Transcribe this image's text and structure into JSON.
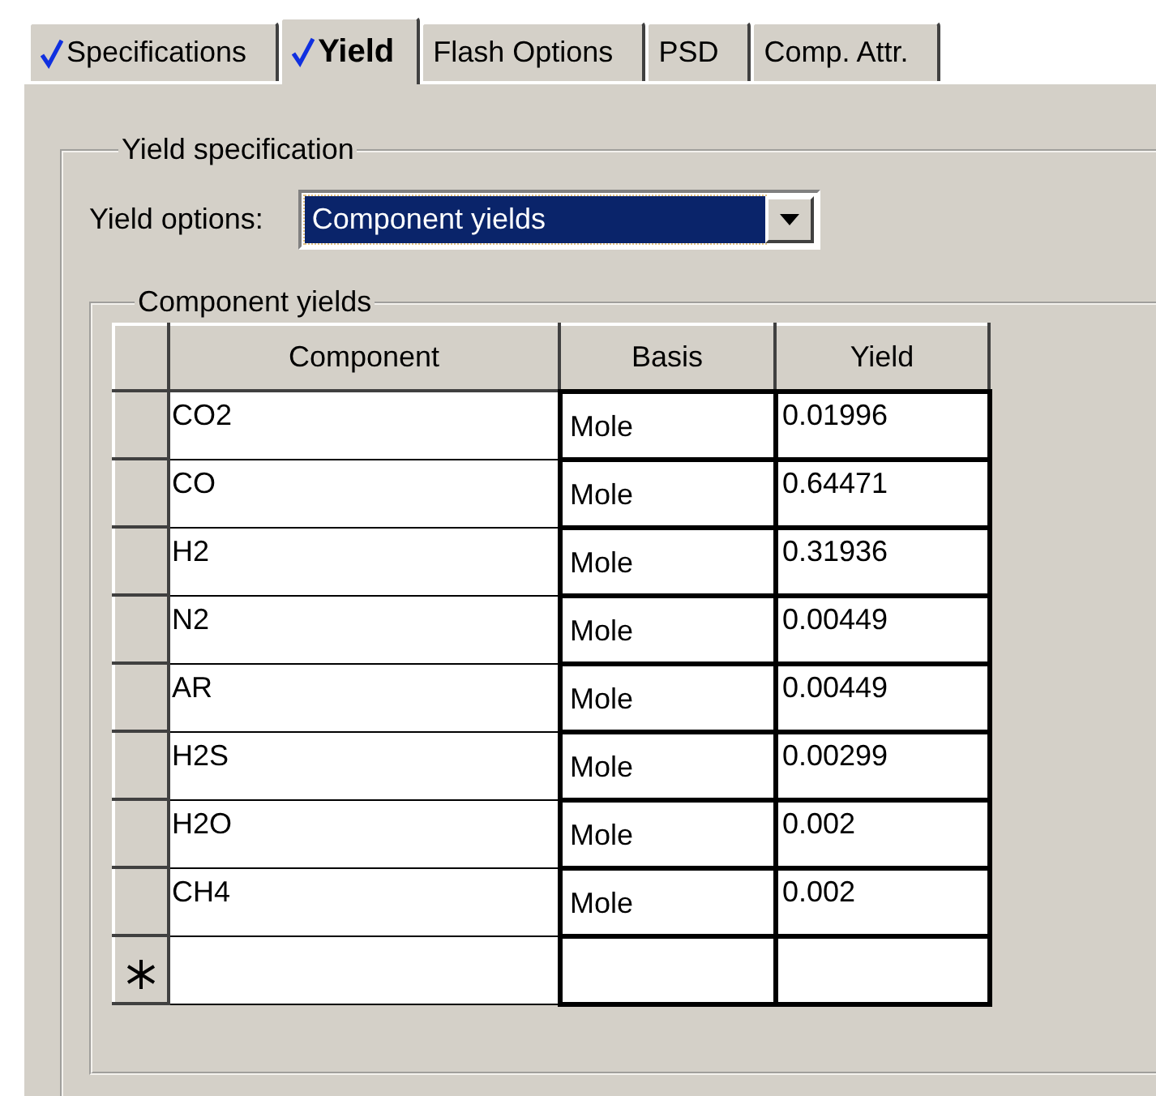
{
  "tabs": [
    {
      "label": "Specifications",
      "checked": true,
      "selected": false
    },
    {
      "label": "Yield",
      "checked": true,
      "selected": true
    },
    {
      "label": "Flash Options",
      "checked": false,
      "selected": false
    },
    {
      "label": "PSD",
      "checked": false,
      "selected": false
    },
    {
      "label": "Comp. Attr.",
      "checked": false,
      "selected": false
    }
  ],
  "yield_specification": {
    "title": "Yield specification",
    "yield_options": {
      "label": "Yield options:",
      "value": "Component yields"
    }
  },
  "component_yields": {
    "title": "Component yields",
    "columns": [
      "Component",
      "Basis",
      "Yield"
    ],
    "rows": [
      {
        "component": "CO2",
        "basis": "Mole",
        "yield": "0.01996"
      },
      {
        "component": "CO",
        "basis": "Mole",
        "yield": "0.64471"
      },
      {
        "component": "H2",
        "basis": "Mole",
        "yield": "0.31936"
      },
      {
        "component": "N2",
        "basis": "Mole",
        "yield": "0.00449"
      },
      {
        "component": "AR",
        "basis": "Mole",
        "yield": "0.00449"
      },
      {
        "component": "H2S",
        "basis": "Mole",
        "yield": "0.00299"
      },
      {
        "component": "H2O",
        "basis": "Mole",
        "yield": "0.002"
      },
      {
        "component": "CH4",
        "basis": "Mole",
        "yield": "0.002"
      }
    ]
  }
}
